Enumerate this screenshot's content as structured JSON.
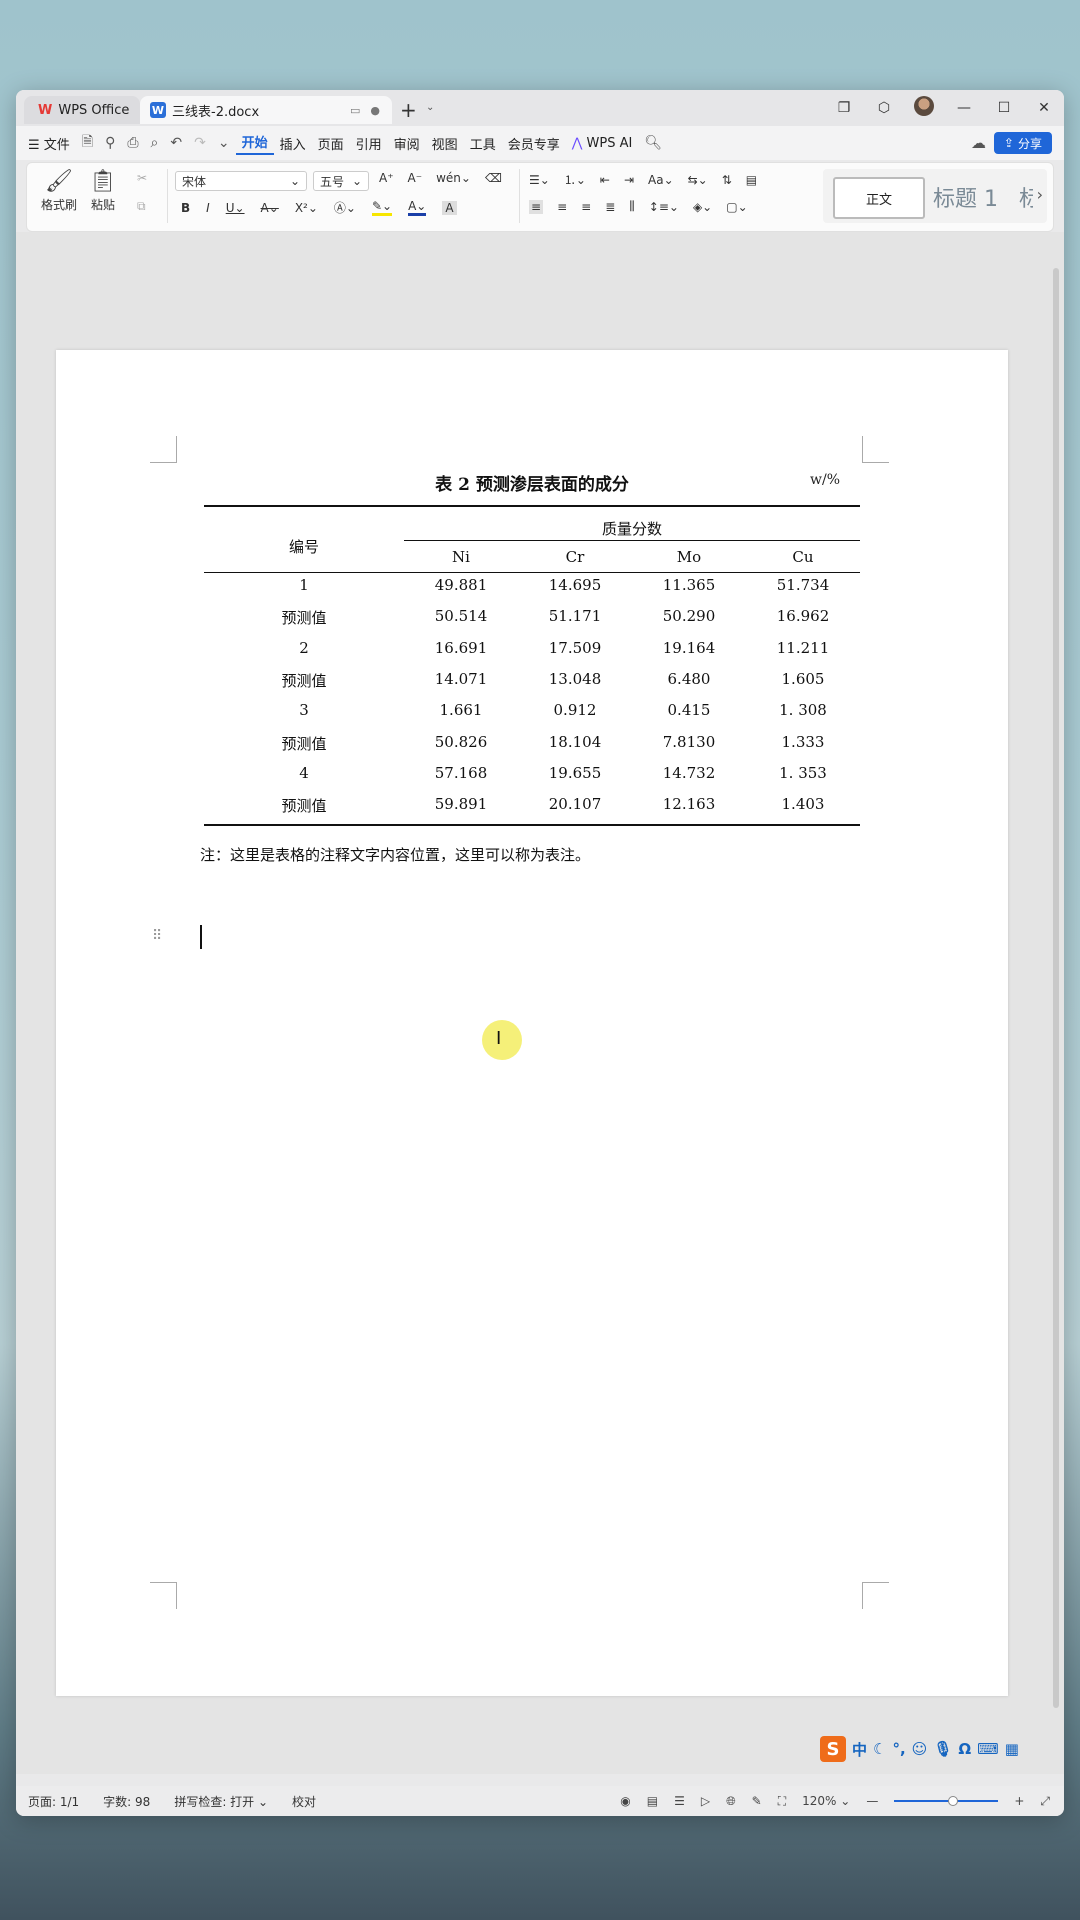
{
  "titlebar": {
    "app_tab": "WPS Office",
    "doc_tab": "三线表-2.docx",
    "window_controls": [
      "restore-icon",
      "box-icon",
      "minimize-icon",
      "maximize-icon",
      "close-icon"
    ]
  },
  "menu": {
    "file": "文件",
    "tabs": [
      "开始",
      "插入",
      "页面",
      "引用",
      "审阅",
      "视图",
      "工具",
      "会员专享"
    ],
    "active_tab": "开始",
    "ai": "WPS AI",
    "share": "分享"
  },
  "ribbon": {
    "format_painter": "格式刷",
    "paste": "粘贴",
    "font_name": "宋体",
    "font_size": "五号",
    "styles": {
      "normal": "正文",
      "heading1": "标题 1",
      "heading2": "标"
    }
  },
  "document": {
    "caption": "表 2  预测渗层表面的成分",
    "unit": "w/%",
    "header_id": "编号",
    "header_group": "质量分数",
    "columns": [
      "Ni",
      "Cr",
      "Mo",
      "Cu"
    ],
    "rows": [
      {
        "id": "1",
        "v": [
          "49.881",
          "14.695",
          "11.365",
          "51.734"
        ]
      },
      {
        "id": "预测值",
        "v": [
          "50.514",
          "51.171",
          "50.290",
          "16.962"
        ]
      },
      {
        "id": "2",
        "v": [
          "16.691",
          "17.509",
          "19.164",
          "11.211"
        ]
      },
      {
        "id": "预测值",
        "v": [
          "14.071",
          "13.048",
          "6.480",
          "1.605"
        ]
      },
      {
        "id": "3",
        "v": [
          "1.661",
          "0.912",
          "0.415",
          "1. 308"
        ]
      },
      {
        "id": "预测值",
        "v": [
          "50.826",
          "18.104",
          "7.8130",
          "1.333"
        ]
      },
      {
        "id": "4",
        "v": [
          "57.168",
          "19.655",
          "14.732",
          "1. 353"
        ]
      },
      {
        "id": "预测值",
        "v": [
          "59.891",
          "20.107",
          "12.163",
          "1.403"
        ]
      }
    ],
    "note": "注：这里是表格的注释文字内容位置，这里可以称为表注。"
  },
  "status": {
    "page": "页面: 1/1",
    "words": "字数: 98",
    "spellcheck": "拼写检查: 打开",
    "proof": "校对",
    "zoom": "120%"
  },
  "ime": {
    "mode": "中"
  }
}
